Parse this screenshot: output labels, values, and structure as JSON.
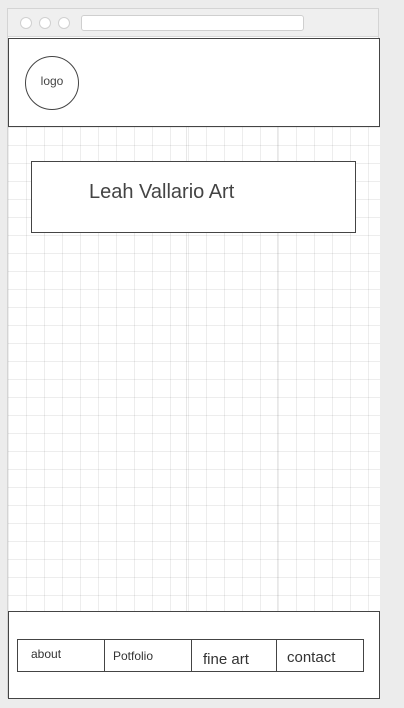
{
  "header": {
    "logo_label": "logo"
  },
  "hero": {
    "title": "Leah Vallario Art"
  },
  "nav": {
    "items": [
      {
        "label": "about"
      },
      {
        "label": "Potfolio"
      },
      {
        "label": "fine art"
      },
      {
        "label": "contact"
      }
    ]
  }
}
